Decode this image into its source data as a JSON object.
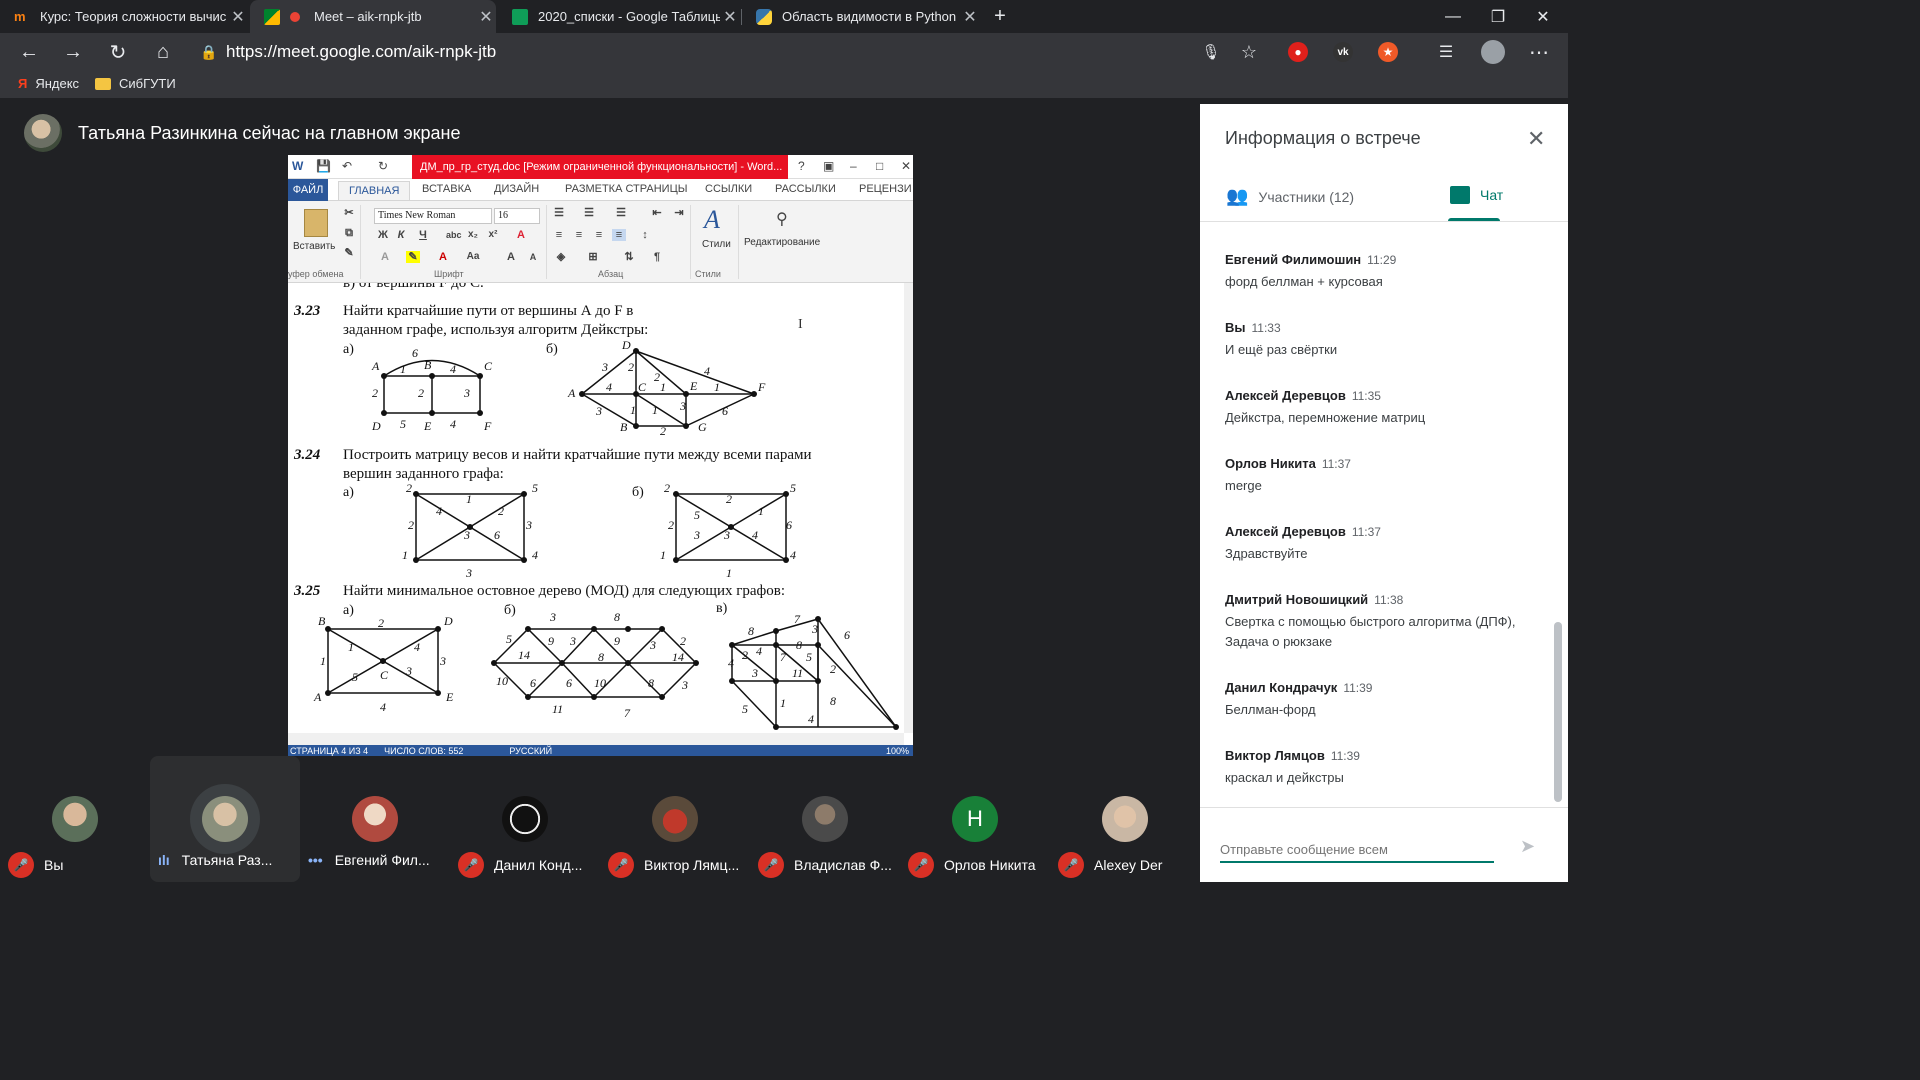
{
  "browser": {
    "tabs": [
      {
        "title": "Курс: Теория сложности вычис",
        "icon": "moodle-icon"
      },
      {
        "title": "Meet – aik-rnpk-jtb",
        "icon": "meet-icon"
      },
      {
        "title": "2020_списки - Google Таблицы",
        "icon": "sheets-icon"
      },
      {
        "title": "Область видимости в Python",
        "icon": "python-icon"
      }
    ],
    "url": "https://meet.google.com/aik-rnpk-jtb",
    "bookmarks": [
      "Яндекс",
      "СибГУТИ"
    ]
  },
  "meet": {
    "presenter_banner": "Татьяна Разинкина сейчас на главном экране"
  },
  "word": {
    "title": "ДМ_пр_гр_студ.doc [Режим ограниченной функциональности] - Word...",
    "file_tab": "ФАЙЛ",
    "tabs": [
      "ГЛАВНАЯ",
      "ВСТАВКА",
      "ДИЗАЙН",
      "РАЗМЕТКА СТРАНИЦЫ",
      "ССЫЛКИ",
      "РАССЫЛКИ",
      "РЕЦЕНЗИ"
    ],
    "ribbon": {
      "paste": "Вставить",
      "font_name": "Times New Roman",
      "font_size": "16",
      "styles": "Стили",
      "editing": "Редактирование",
      "groups": [
        "уфер обмена",
        "Шрифт",
        "Абзац",
        "Стили"
      ]
    },
    "doc": {
      "partial_line": "в) от вершины F до C.",
      "p323_num": "3.23",
      "p323_l1": "Найти кратчайшие пути от вершины А до F в",
      "p323_l2": "заданном графе, используя алгоритм Дейкстры:",
      "p324_num": "3.24",
      "p324_l1": "Построить матрицу весов и найти кратчайшие пути между всеми парами",
      "p324_l2": "вершин заданного графа:",
      "p325_num": "3.25",
      "p325_l1": "Найти минимальное остовное дерево (МОД) для следующих графов:",
      "sub_a": "а)",
      "sub_b": "б)",
      "sub_v": "в)"
    },
    "status": {
      "page": "СТРАНИЦА 4 ИЗ 4",
      "words": "ЧИСЛО СЛОВ: 552",
      "lang": "РУССКИЙ",
      "zoom": "100%"
    }
  },
  "panel": {
    "title": "Информация о встрече",
    "tab_people": "Участники (12)",
    "tab_chat": "Чат",
    "messages": [
      {
        "name": "Евгений Филимошин",
        "time": "11:29",
        "text": "форд беллман + курсовая"
      },
      {
        "name": "Вы",
        "time": "11:33",
        "text": "И ещё раз свёртки"
      },
      {
        "name": "Алексей Деревцов",
        "time": "11:35",
        "text": "Дейкстра, перемножение матриц"
      },
      {
        "name": "Орлов Никита",
        "time": "11:37",
        "text": "merge"
      },
      {
        "name": "Алексей Деревцов",
        "time": "11:37",
        "text": "Здравствуйте"
      },
      {
        "name": "Дмитрий Новошицкий",
        "time": "11:38",
        "text": "Свертка с помощью быстрого алгоритма (ДПФ), Задача о рюкзаке"
      },
      {
        "name": "Данил Кондрачук",
        "time": "11:39",
        "text": "Беллман-форд"
      },
      {
        "name": "Виктор Лямцов",
        "time": "11:39",
        "text": "краскал и дейкстры"
      }
    ],
    "composer_placeholder": "Отправьте сообщение всем"
  },
  "participants": [
    {
      "label": "Вы",
      "status": "muted",
      "avatar_color": "#5b6f5a"
    },
    {
      "label": "Татьяна Раз...",
      "status": "speaking",
      "avatar_color": "#8a8f7c"
    },
    {
      "label": "Евгений Фил...",
      "status": "dots",
      "avatar_color": "#b04a3f"
    },
    {
      "label": "Данил Конд...",
      "status": "muted",
      "avatar_color": "#111111"
    },
    {
      "label": "Виктор Лямц...",
      "status": "muted",
      "avatar_color": "#9c3a2e"
    },
    {
      "label": "Владислав Ф...",
      "status": "muted",
      "avatar_color": "#4a4a4a"
    },
    {
      "label": "Орлов Никита",
      "status": "muted",
      "avatar_letter": "Н",
      "avatar_color": "#188038"
    },
    {
      "label": "Alexey Der",
      "status": "muted",
      "avatar_color": "#c9b7a4"
    }
  ]
}
